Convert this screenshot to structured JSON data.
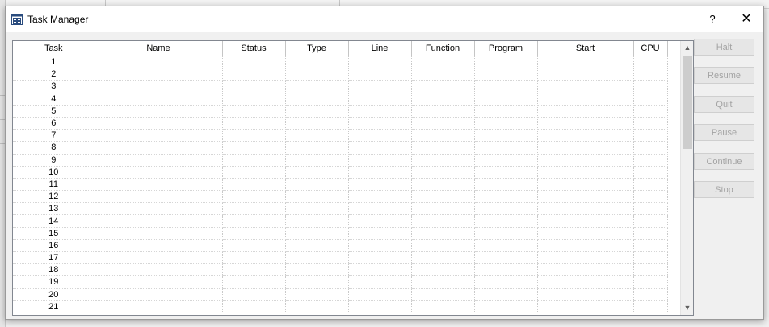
{
  "dialog": {
    "title": "Task Manager",
    "help_label": "?",
    "close_label": "✕"
  },
  "table": {
    "columns": [
      "Task",
      "Name",
      "Status",
      "Type",
      "Line",
      "Function",
      "Program",
      "Start",
      "CPU"
    ],
    "rows": [
      "1",
      "2",
      "3",
      "4",
      "5",
      "6",
      "7",
      "8",
      "9",
      "10",
      "11",
      "12",
      "13",
      "14",
      "15",
      "16",
      "17",
      "18",
      "19",
      "20",
      "21"
    ]
  },
  "scrollbar": {
    "up_arrow": "▲",
    "down_arrow": "▼"
  },
  "buttons": {
    "halt": "Halt",
    "resume": "Resume",
    "quit": "Quit",
    "pause": "Pause",
    "continue": "Continue",
    "stop": "Stop"
  },
  "colors": {
    "disabled_text": "#a3a3a3",
    "dialog_bg": "#f0f0f0"
  }
}
